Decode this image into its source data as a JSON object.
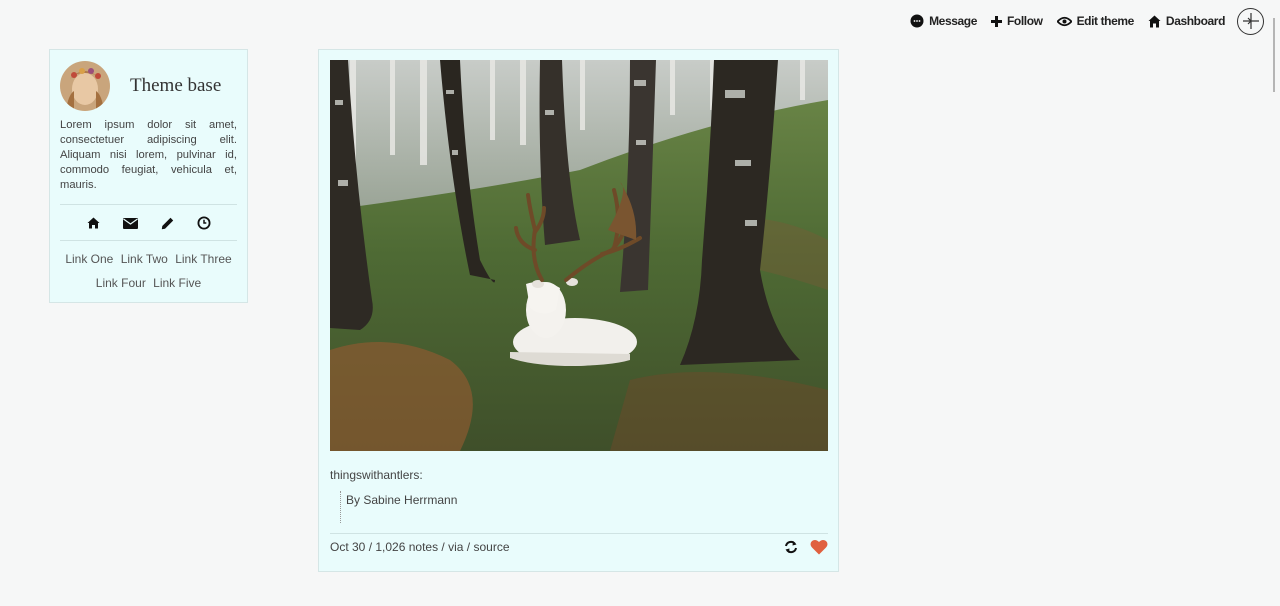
{
  "topbar": {
    "message": {
      "label": "Message",
      "icon": "message-bubble-icon"
    },
    "follow": {
      "label": "Follow",
      "icon": "plus-icon"
    },
    "edit_theme": {
      "label": "Edit theme",
      "icon": "eye-icon"
    },
    "dashboard": {
      "label": "Dashboard",
      "icon": "home-icon"
    },
    "logo": {
      "icon": "tumblr-circle-icon"
    }
  },
  "sidebar": {
    "title": "Theme base",
    "description": "Lorem ipsum dolor sit amet, consectetuer adipiscing elit. Aliquam nisi lorem, pulvinar id, commodo feugiat, vehicula et, mauris.",
    "icons": [
      "home-icon",
      "mail-icon",
      "pencil-icon",
      "clock-icon"
    ],
    "links": [
      "Link One",
      "Link Two",
      "Link Three",
      "Link Four",
      "Link Five"
    ]
  },
  "post": {
    "source_blog": "thingswithantlers:",
    "quote": "By Sabine Herrmann",
    "date": "Oct 30",
    "notes": "1,026 notes",
    "via": "via",
    "source": "source",
    "sep": " / ",
    "like_color": "#e0603f"
  },
  "colors": {
    "background": "#f6f7f7",
    "panel": "#e9fcfc"
  }
}
